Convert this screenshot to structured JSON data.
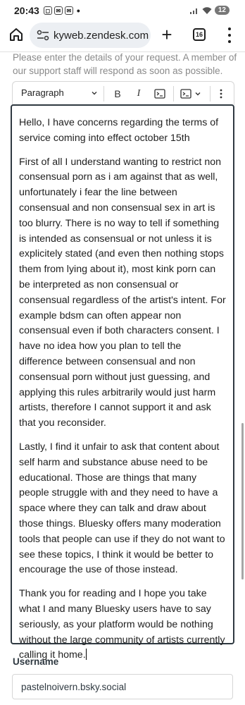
{
  "status_bar": {
    "time": "20:43",
    "battery": "12"
  },
  "browser": {
    "url": "kyweb.zendesk.com",
    "tab_count": "16"
  },
  "form": {
    "hint": "Please enter the details of your request. A member of our support staff will respond as soon as possible.",
    "toolbar": {
      "paragraph_label": "Paragraph",
      "bold_label": "B",
      "italic_label": "I"
    },
    "description_paragraphs": [
      "Hello, I have concerns regarding the terms of service coming into effect october 15th",
      "First of all I understand wanting to restrict non consensual porn as i am against that as well, unfortunately i fear the line between consensual and non consensual sex in art is too blurry. There is no way to tell if something is intended as consensual or not unless it is explicitely stated (and even then nothing stops them from lying about it), most kink porn can be interpreted as non consensual or consensual regardless of the artist's intent. For example bdsm can often appear non consensual even if both characters consent. I have no idea how you plan to tell the difference between consensual and non consensual porn without just guessing, and applying this rules arbitrarily would just harm artists, therefore I cannot support it and ask that you reconsider.",
      "Lastly, I find it unfair to ask that content about self harm and substance abuse need to be educational. Those are things that many people struggle with and they need to have a space where they can talk and draw about those things. Bluesky offers many moderation tools that people can use if they do not want to see these topics, I think it would be better to encourage the use of those instead.",
      "Thank you for reading and I hope you take what I and many Bluesky users have to say seriously, as your platform would be nothing without the large community of artists currently calling it home."
    ],
    "username_label": "Username",
    "username_value": "pastelnoivern.bsky.social"
  },
  "icons": [
    "home-icon",
    "site-settings-icon",
    "new-tab-icon",
    "tabs-icon",
    "more-menu-icon",
    "chevron-down-icon",
    "code-icon",
    "code-block-icon",
    "more-options-icon",
    "signal-icon",
    "wifi-icon"
  ]
}
